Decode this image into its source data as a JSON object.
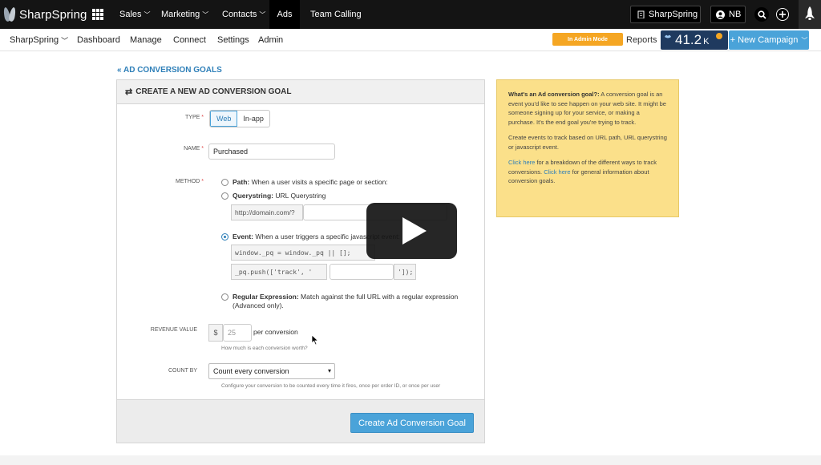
{
  "brand": {
    "name": "SharpSpring"
  },
  "topnav": {
    "sales": "Sales",
    "marketing": "Marketing",
    "contacts": "Contacts",
    "ads": "Ads",
    "team_calling": "Team Calling"
  },
  "topright": {
    "account": "SharpSpring",
    "user_initials": "NB"
  },
  "subnav": {
    "account": "SharpSpring",
    "dashboard": "Dashboard",
    "manage": "Manage",
    "connect": "Connect",
    "settings": "Settings",
    "admin": "Admin"
  },
  "admin_mode": "In Admin Mode",
  "reports": "Reports",
  "score": {
    "value": "41.2",
    "unit": "K"
  },
  "new_campaign": "+ New Campaign",
  "back_link": "« AD CONVERSION GOALS",
  "form": {
    "title": "CREATE A NEW AD CONVERSION GOAL",
    "type_label": "TYPE",
    "type_options": [
      "Web",
      "In-app"
    ],
    "name_label": "NAME",
    "name_value": "Purchased",
    "method_label": "METHOD",
    "methods": {
      "path_title": "Path:",
      "path_desc": "When a user visits a specific page or section:",
      "query_title": "Querystring:",
      "query_desc": "URL Querystring",
      "query_prefix": "http://domain.com/?",
      "event_title": "Event:",
      "event_desc": "When a user triggers a specific javascript event:",
      "event_code1": "window._pq = window._pq || [];",
      "event_code2": "_pq.push(['track', '",
      "event_code3": "']);",
      "regex_title": "Regular Expression:",
      "regex_desc": "Match against the full URL with a regular expression (Advanced only)."
    },
    "revenue_label": "REVENUE VALUE",
    "currency": "$",
    "revenue_placeholder": "25",
    "per_conversion": "per conversion",
    "revenue_hint": "How much is each conversion worth?",
    "count_label": "COUNT BY",
    "count_value": "Count every conversion",
    "count_hint": "Configure your conversion to be counted every time it fires, once per order ID, or once per user",
    "submit": "Create Ad Conversion Goal"
  },
  "help": {
    "title": "What's an Ad conversion goal?:",
    "p1": "A conversion goal is an event you'd like to see happen on your web site. It might be someone signing up for your service, or making a purchase. It's the end goal you're trying to track.",
    "p2": "Create events to track based on URL path, URL querystring or javascript event.",
    "link1": "Click here",
    "p3a": "for a breakdown of the different ways to track conversions.",
    "link2": "Click here",
    "p3b": "for general information about conversion goals."
  },
  "colors": {
    "accent": "#4aa3d9",
    "topbar": "#141414",
    "admin_badge": "#f5a623",
    "help_bg": "#fbe08a",
    "score_bg": "#1f3a5f"
  },
  "icons": [
    "grid-icon",
    "user-icon",
    "search-icon",
    "plus-icon",
    "rocket-icon",
    "play-icon",
    "swap-icon",
    "chevron-down-icon"
  ]
}
